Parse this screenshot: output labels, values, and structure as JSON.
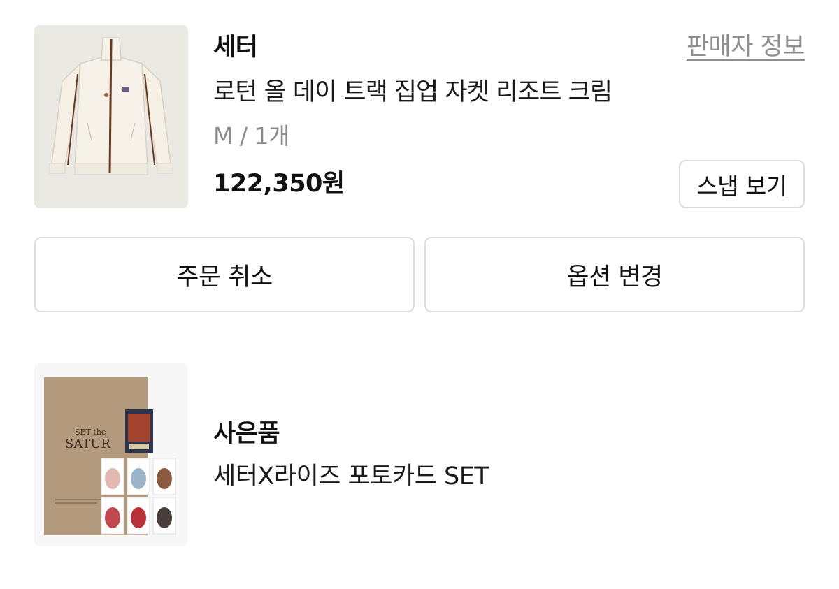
{
  "product": {
    "brand": "세터",
    "seller_info_link": "판매자 정보",
    "name": "로턴 올 데이 트랙 집업 자켓 리조트 크림",
    "option": "M / 1개",
    "price": "122,350원",
    "snap_button": "스냅 보기",
    "image_icon": "jacket-photo",
    "colors": {
      "jacket": "#f4f0e6",
      "trim": "#6b3a22",
      "background": "#ebe9e4"
    }
  },
  "actions": {
    "cancel_order": "주문 취소",
    "change_option": "옵션 변경"
  },
  "gift": {
    "label": "사은품",
    "name": "세터X라이즈 포토카드 SET",
    "image_icon": "photocard-set-photo",
    "book_title": "SATUR",
    "book_subtitle": "SET the"
  }
}
